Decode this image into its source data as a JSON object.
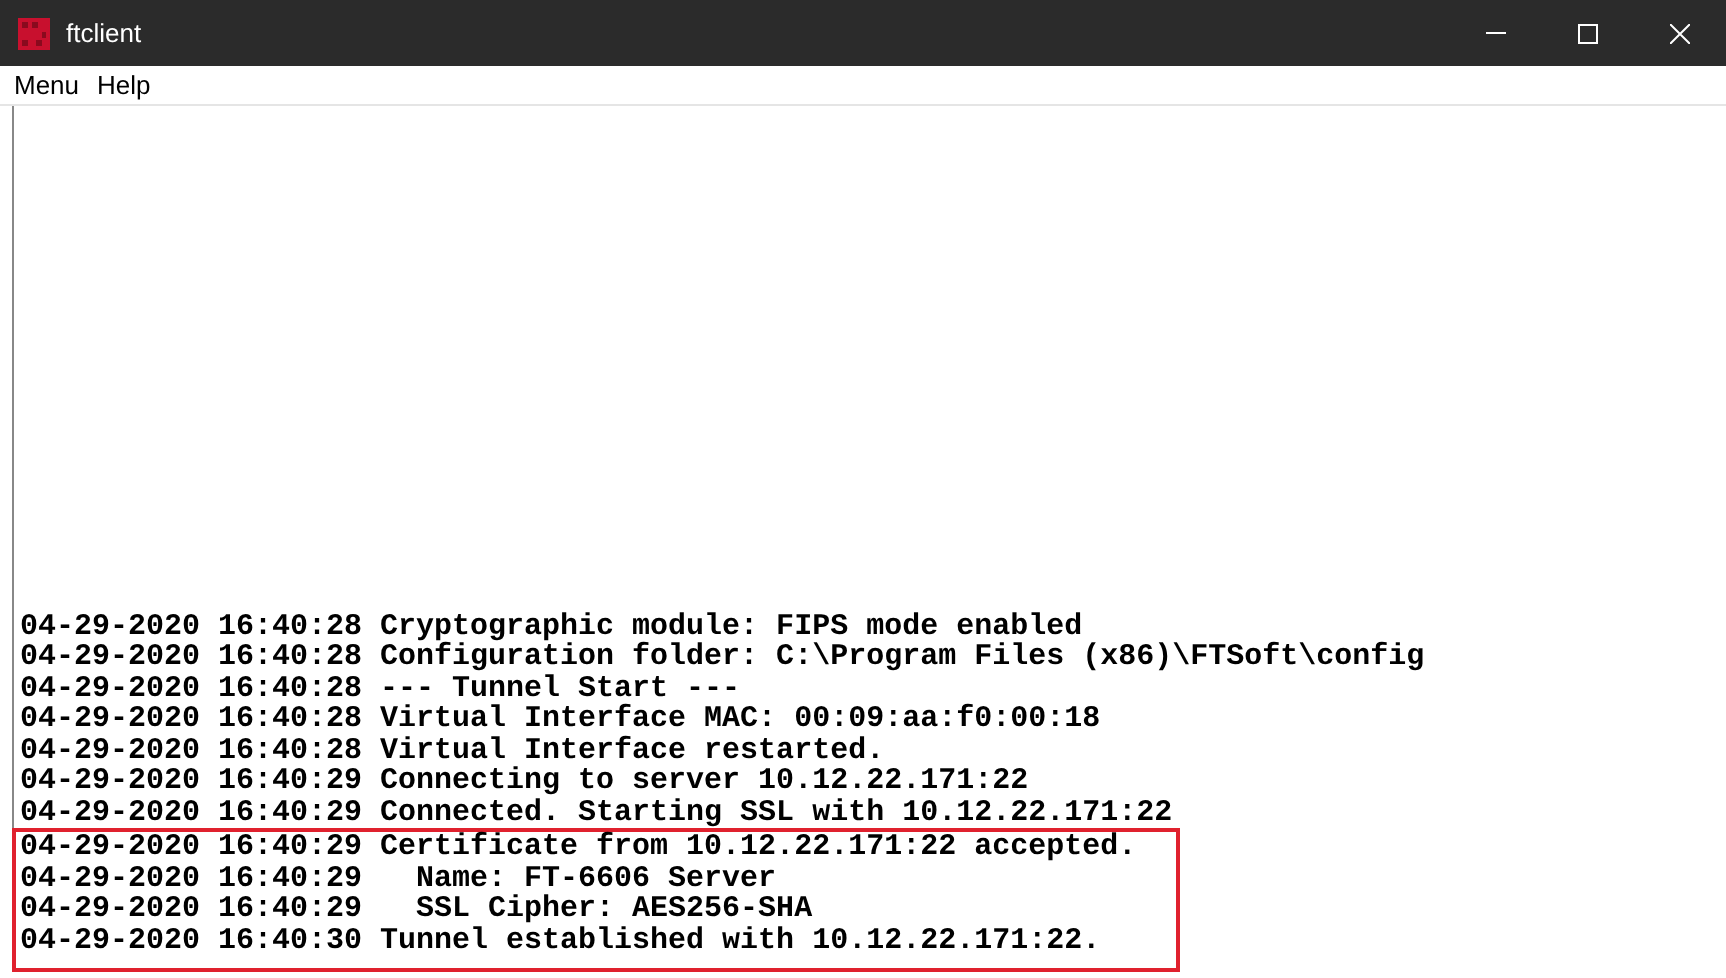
{
  "window": {
    "title": "ftclient"
  },
  "menu": [
    "Menu",
    "Help"
  ],
  "log": [
    "04-29-2020 16:40:28 Cryptographic module: FIPS mode enabled",
    "04-29-2020 16:40:28 Configuration folder: C:\\Program Files (x86)\\FTSoft\\config",
    "04-29-2020 16:40:28 --- Tunnel Start ---",
    "04-29-2020 16:40:28 Virtual Interface MAC: 00:09:aa:f0:00:18",
    "04-29-2020 16:40:28 Virtual Interface restarted.",
    "04-29-2020 16:40:29 Connecting to server 10.12.22.171:22",
    "04-29-2020 16:40:29 Connected. Starting SSL with 10.12.22.171:22"
  ],
  "highlighted_log": [
    "04-29-2020 16:40:29 Certificate from 10.12.22.171:22 accepted.",
    "04-29-2020 16:40:29   Name: FT-6606 Server",
    "04-29-2020 16:40:29   SSL Cipher: AES256-SHA",
    "04-29-2020 16:40:30 Tunnel established with 10.12.22.171:22."
  ]
}
